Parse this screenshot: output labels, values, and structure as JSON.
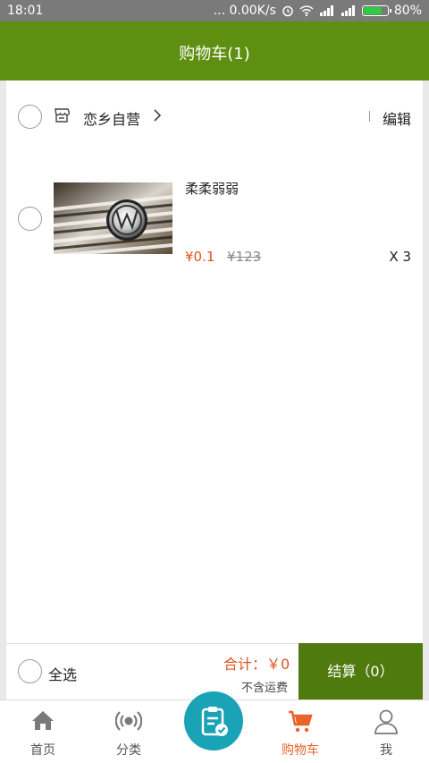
{
  "status_bar": {
    "time": "18:01",
    "network_speed": "... 0.00K/s",
    "battery_percent": "80%",
    "battery_level": 0.8
  },
  "header": {
    "title": "购物车(1)"
  },
  "shop": {
    "name": "恋乡自营",
    "edit_label": "编辑",
    "icon": "store-icon"
  },
  "cart_items": [
    {
      "title": "柔柔弱弱",
      "price": "¥0.1",
      "original_price": "¥123",
      "quantity": "X 3",
      "image": "vw-grille-photo"
    }
  ],
  "checkout": {
    "select_all_label": "全选",
    "total_label": "合计：￥0",
    "shipping_note": "不含运费",
    "checkout_button": "结算（0）"
  },
  "tabs": [
    {
      "label": "首页",
      "icon": "home-icon"
    },
    {
      "label": "分类",
      "icon": "signal-icon"
    },
    {
      "label": "",
      "icon": "clipboard-check-icon"
    },
    {
      "label": "购物车",
      "icon": "cart-icon",
      "active": true
    },
    {
      "label": "我",
      "icon": "user-icon"
    }
  ],
  "colors": {
    "header": "#5f8f10",
    "checkout_button": "#4f7a0e",
    "accent_price": "#e0531f",
    "tab_active": "#e8642a",
    "center_tab": "#1aa3b6"
  }
}
